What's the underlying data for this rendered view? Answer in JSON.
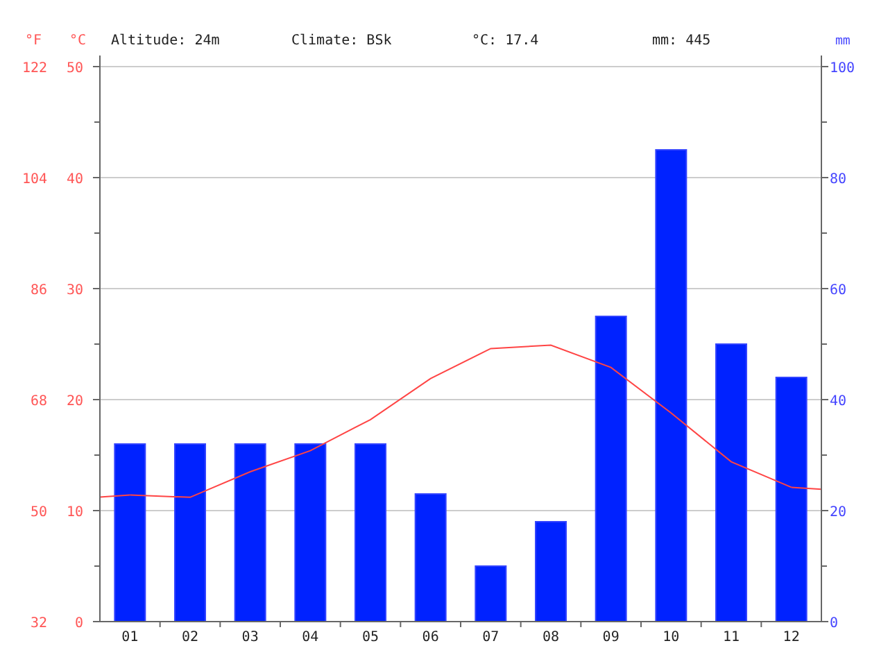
{
  "units": {
    "fahrenheit": "°F"
  },
  "summary": [
    {
      "text": "Altitude: 24m"
    },
    {
      "text": "Climate: BSk"
    },
    {
      "text": "°C: 17.4"
    },
    {
      "text": "mm: 445"
    }
  ],
  "fahrenheit_labels": [
    "122",
    "104",
    "86",
    "68",
    "50",
    "32"
  ],
  "chart_data": {
    "type": "bar",
    "categories": [
      "01",
      "02",
      "03",
      "04",
      "05",
      "06",
      "07",
      "08",
      "09",
      "10",
      "11",
      "12"
    ],
    "grid": true,
    "ylim": [
      0,
      50
    ],
    "yticks": [
      0,
      10,
      20,
      30,
      40,
      50
    ],
    "y2lim": [
      0,
      100
    ],
    "y2ticks": [
      0,
      20,
      40,
      60,
      80,
      100
    ],
    "series": [
      {
        "name": "mm",
        "type": "bar",
        "axis": "y2",
        "color": "#0022ff",
        "values": [
          32,
          32,
          32,
          32,
          32,
          23,
          10,
          18,
          55,
          85,
          50,
          44
        ]
      },
      {
        "name": "°C",
        "type": "line",
        "color": "#ff4444",
        "values": [
          11.4,
          11.2,
          13.5,
          15.4,
          18.2,
          21.9,
          24.6,
          24.9,
          22.9,
          18.8,
          14.4,
          12.1
        ]
      }
    ]
  }
}
